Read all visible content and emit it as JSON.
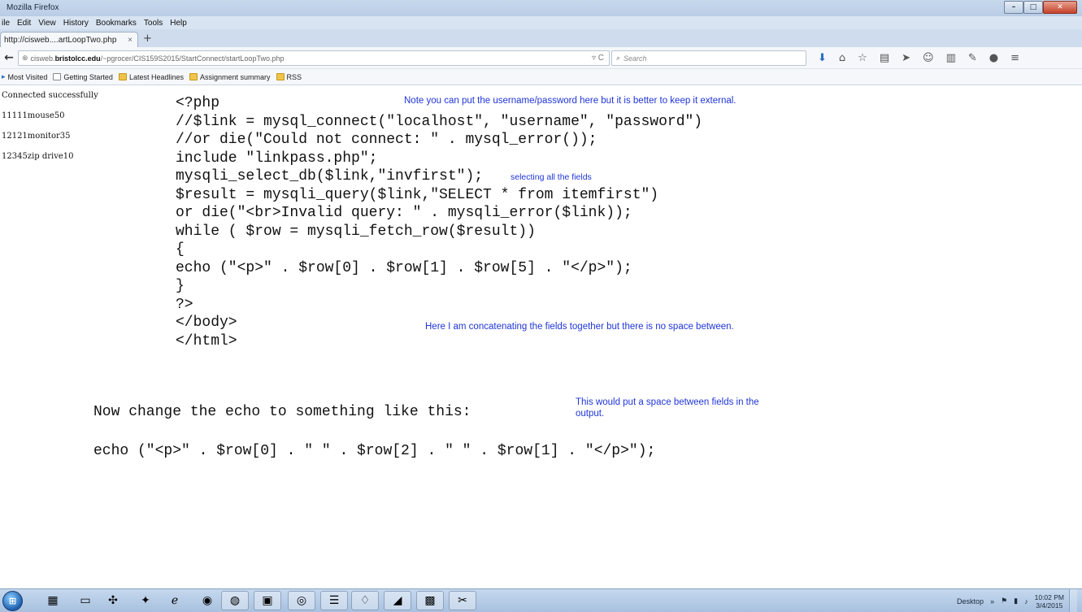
{
  "window": {
    "title": "Mozilla Firefox",
    "controls": {
      "minimize": "–",
      "maximize": "□",
      "close": "✕"
    }
  },
  "menu": [
    "ile",
    "Edit",
    "View",
    "History",
    "Bookmarks",
    "Tools",
    "Help"
  ],
  "tab": {
    "label": "http://cisweb....artLoopTwo.php",
    "close": "×",
    "new_tab": "+"
  },
  "nav": {
    "back": "←",
    "url_host_prefix": "cisweb.",
    "url_host": "bristolcc.edu",
    "url_path": "/~pgrocer/CIS159S2015/StartConnect/startLoopTwo.php",
    "reload": "▿ C",
    "search_placeholder": "Search"
  },
  "toolbar_icons": [
    {
      "name": "download-icon",
      "glyph": "⬇",
      "blue": true
    },
    {
      "name": "home-icon",
      "glyph": "⌂",
      "blue": false
    },
    {
      "name": "star-icon",
      "glyph": "☆",
      "blue": false
    },
    {
      "name": "reader-icon",
      "glyph": "▤",
      "blue": false
    },
    {
      "name": "send-icon",
      "glyph": "➤",
      "blue": false
    },
    {
      "name": "hello-icon",
      "glyph": "☺",
      "blue": false
    },
    {
      "name": "library-icon",
      "glyph": "▥",
      "blue": false
    },
    {
      "name": "addon-icon",
      "glyph": "✎",
      "blue": false
    },
    {
      "name": "chat-icon",
      "glyph": "●",
      "blue": false
    },
    {
      "name": "hamburger-menu-icon",
      "glyph": "≡",
      "blue": false
    }
  ],
  "bookmarks": [
    {
      "label": "Most Visited",
      "kind": "mv"
    },
    {
      "label": "Getting Started",
      "kind": "page"
    },
    {
      "label": "Latest Headlines",
      "kind": "folder"
    },
    {
      "label": "Assignment summary",
      "kind": "folder"
    },
    {
      "label": "RSS",
      "kind": "folder"
    }
  ],
  "page_output": [
    "Connected successfully",
    "11111mouse50",
    "12121monitor35",
    "12345zip drive10"
  ],
  "code_lines": [
    "<?php",
    "//$link = mysql_connect(\"localhost\", \"username\", \"password\")",
    "//or die(\"Could not connect: \" . mysql_error());",
    "include \"linkpass.php\";",
    "mysqli_select_db($link,\"invfirst\");",
    "$result = mysqli_query($link,\"SELECT * from itemfirst\")",
    "or die(\"<br>Invalid query: \" . mysqli_error($link));",
    "while ( $row = mysqli_fetch_row($result))",
    "{",
    "echo (\"<p>\" . $row[0] . $row[1] . $row[5] . \"</p>\");",
    "}",
    "?>",
    "</body>",
    "</html>"
  ],
  "notes": {
    "credentials": "Note you can put the username/password here but it is better to keep it external.",
    "select_fields": "selecting all the fields",
    "concatenating": "Here I am concatenating the fields together but there is no space between.",
    "space_line1": "This would put a space between fields in the",
    "space_line2": "output."
  },
  "instruction": "Now change the echo to something like this:",
  "new_echo": "echo (\"<p>\" . $row[0] . \" \" . $row[2] . \" \" . $row[1] . \"</p>\");",
  "taskbar": {
    "tasks": [
      {
        "name": "calculator-task",
        "glyph": "▦",
        "running": false
      },
      {
        "name": "explorer-task",
        "glyph": "▭",
        "running": false
      },
      {
        "name": "network-task",
        "glyph": "✣",
        "running": false
      },
      {
        "name": "app-task",
        "glyph": "✦",
        "running": false
      },
      {
        "name": "ie-task",
        "glyph": "ℯ",
        "running": false
      },
      {
        "name": "chrome-task",
        "glyph": "◉",
        "running": false
      },
      {
        "name": "firefox-task",
        "glyph": "◍",
        "running": true
      },
      {
        "name": "window-task",
        "glyph": "▣",
        "running": true
      },
      {
        "name": "media-task",
        "glyph": "◎",
        "running": true
      },
      {
        "name": "chat-task",
        "glyph": "☰",
        "running": true
      },
      {
        "name": "acrobat-task",
        "glyph": "♢",
        "running": true
      },
      {
        "name": "paint-task",
        "glyph": "◢",
        "running": true
      },
      {
        "name": "tools-task",
        "glyph": "▩",
        "running": true
      },
      {
        "name": "snip-task",
        "glyph": "✂",
        "running": true
      }
    ],
    "tray_label": "Desktop",
    "tray_chevron": "»",
    "clock_time": "10:02 PM",
    "clock_date": "3/4/2015"
  }
}
